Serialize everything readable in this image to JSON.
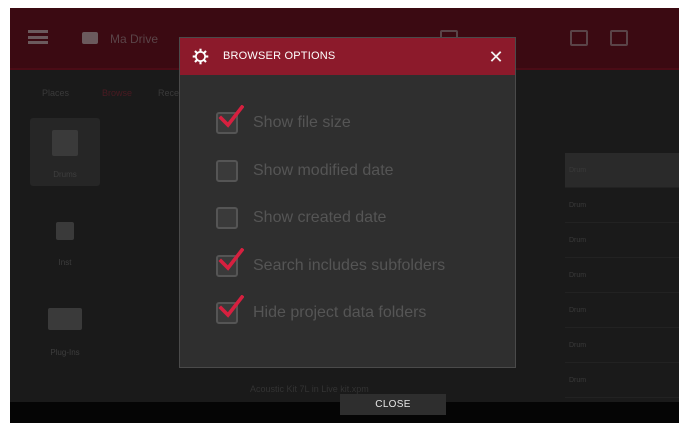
{
  "background": {
    "title": "Ma Drive",
    "tabs": [
      "Places",
      "Browse",
      "Recent"
    ],
    "categories": [
      "Drums",
      "Inst",
      "Plug-Ins"
    ],
    "file_item": "Acoustic Kit 7L in Live kit.xpm",
    "right_rows": [
      "Drum",
      "Drum",
      "Drum",
      "Drum",
      "Drum",
      "Drum",
      "Drum"
    ]
  },
  "dialog": {
    "title": "BROWSER OPTIONS",
    "close_symbol": "✕",
    "options": [
      {
        "label": "Show file size",
        "checked": true
      },
      {
        "label": "Show modified date",
        "checked": false
      },
      {
        "label": "Show created date",
        "checked": false
      },
      {
        "label": "Search includes subfolders",
        "checked": true
      },
      {
        "label": "Hide project data folders",
        "checked": true
      }
    ]
  },
  "footer": {
    "close_label": "CLOSE"
  },
  "colors": {
    "accent": "#8c1a2b",
    "check": "#d6203f"
  }
}
